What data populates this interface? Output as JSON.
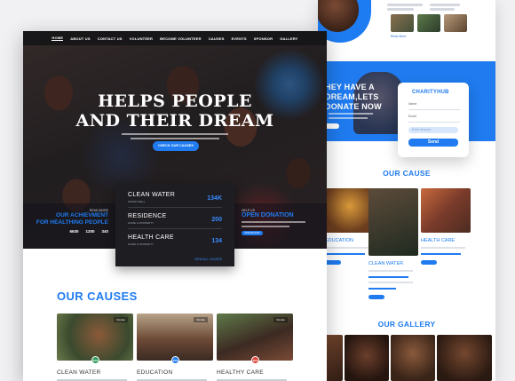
{
  "background_page": {
    "more_link": "Read More",
    "donate_heading": "HEY HAVE A\nDREAM,LETS\nDONATE NOW",
    "form": {
      "logo": "CHARITYHUB",
      "name_label": "Name",
      "email_label": "Email",
      "amount_placeholder": "Enter Amount",
      "send_label": "Send"
    },
    "our_cause_title": "OUR CAUSE",
    "causes": [
      {
        "title": "EDUCATION"
      },
      {
        "title": "CLEAN WATER"
      },
      {
        "title": "HEALTH CARE"
      }
    ],
    "gallery_title": "OUR GALLERY"
  },
  "front_page": {
    "nav": [
      "HOME",
      "ABOUT US",
      "CONTACT US",
      "VOLUNTEER",
      "BECOME VOLUNTEER",
      "CAUSES",
      "EVENTS",
      "SPONSOR",
      "GALLERY"
    ],
    "hero_title_line1": "HELPS PEOPLE",
    "hero_title_line2": "AND THEIR DREAM",
    "hero_button": "CHECK OUR CAUSES",
    "achievement": {
      "kicker": "READ MORE",
      "heading_line1": "OUR ACHIEVMENT",
      "heading_line2": "FOR HEALTHING PEOPLE",
      "numbers": [
        "6630",
        "1200",
        "340"
      ]
    },
    "open_donation": {
      "kicker": "HELP US",
      "heading": "OPEN DONATION",
      "button": "DONATE NOW"
    },
    "stats": [
      {
        "name": "CLEAN WATER",
        "desc": "WATER WELL",
        "value": "134K"
      },
      {
        "name": "RESIDENCE",
        "desc": "HOME & PROPERTY",
        "value": "200"
      },
      {
        "name": "HEALTH CARE",
        "desc": "HOME & PROPERTY",
        "value": "134"
      }
    ],
    "stats_link": "VIEW ALL CAUSES",
    "causes_title": "OUR CAUSES",
    "cause_cards": [
      {
        "title": "CLEAN WATER",
        "tag": "Donate",
        "badge": "50%"
      },
      {
        "title": "EDUCATION",
        "tag": "Donate",
        "badge": "70%"
      },
      {
        "title": "HEALTHY CARE",
        "tag": "Donate",
        "badge": "30%"
      }
    ]
  },
  "colors": {
    "accent": "#1f7bef",
    "dark_panel": "#1d1d22"
  }
}
